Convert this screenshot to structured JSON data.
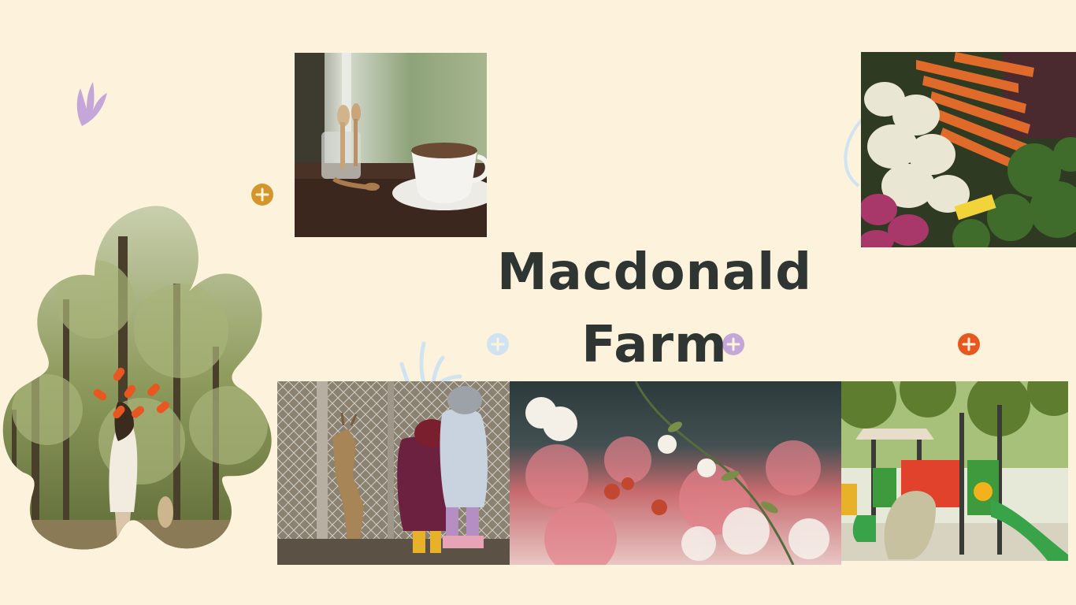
{
  "title": {
    "line1": "Macdonald",
    "line2": "Farm"
  },
  "photos": [
    {
      "name": "coffee-cup-photo"
    },
    {
      "name": "vegetables-photo"
    },
    {
      "name": "forest-walk-photo"
    },
    {
      "name": "kids-feeding-deer-photo"
    },
    {
      "name": "flowers-photo"
    },
    {
      "name": "playground-photo"
    }
  ],
  "colors": {
    "background": "#fdf3dc",
    "title": "#2e3532",
    "accent_gold": "#d4962a",
    "accent_orange": "#e8571f",
    "accent_lilac": "#c4a6d8",
    "accent_blue": "#cfe3f1"
  }
}
